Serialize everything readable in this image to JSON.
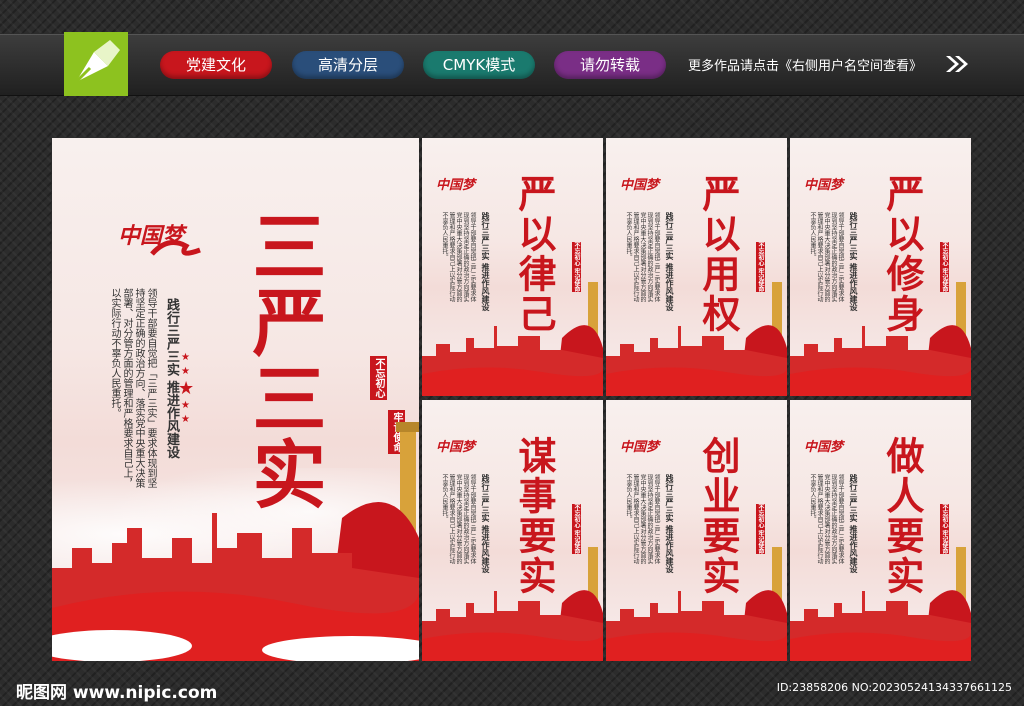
{
  "header": {
    "pills": [
      {
        "label": "党建文化",
        "color": "#c8161d"
      },
      {
        "label": "高清分层",
        "color": "#2a4e7a"
      },
      {
        "label": "CMYK模式",
        "color": "#1a7a6e"
      },
      {
        "label": "请勿转载",
        "color": "#7a2e86"
      }
    ],
    "more_text": "更多作品请点击《右侧用户名空间查看》"
  },
  "main_board": {
    "title": "三严三实",
    "subtitle": "践行三严三实 推进作风建设",
    "body": "领导干部要自觉把「三严三实」要求体现到坚持坚定正确的政治方向、落实党中央重大决策部署、对分管方面的管理和严格要求自己上，以实际行动不辜负人民重托。",
    "seal1": "不忘初心",
    "seal2": "牢记使命",
    "calligraphy": "中国梦"
  },
  "panels": [
    {
      "title": "严以律己"
    },
    {
      "title": "严以用权"
    },
    {
      "title": "严以修身"
    },
    {
      "title": "谋事要实"
    },
    {
      "title": "创业要实"
    },
    {
      "title": "做人要实"
    }
  ],
  "panel_common": {
    "subtitle": "践行三严三实 推进作风建设",
    "body": "领导干部要自觉把三严三实要求体现到坚持坚定正确的政治方向落实党中央重大决策部署对分管方面的管理和严格要求自己上以实际行动不辜负人民重托。",
    "seal": "不忘初心 牢记使命",
    "calligraphy": "中国梦"
  },
  "footer": {
    "logo": "昵图网 www.nipic.com",
    "id": "ID:23858206 NO:20230524134337661125"
  }
}
